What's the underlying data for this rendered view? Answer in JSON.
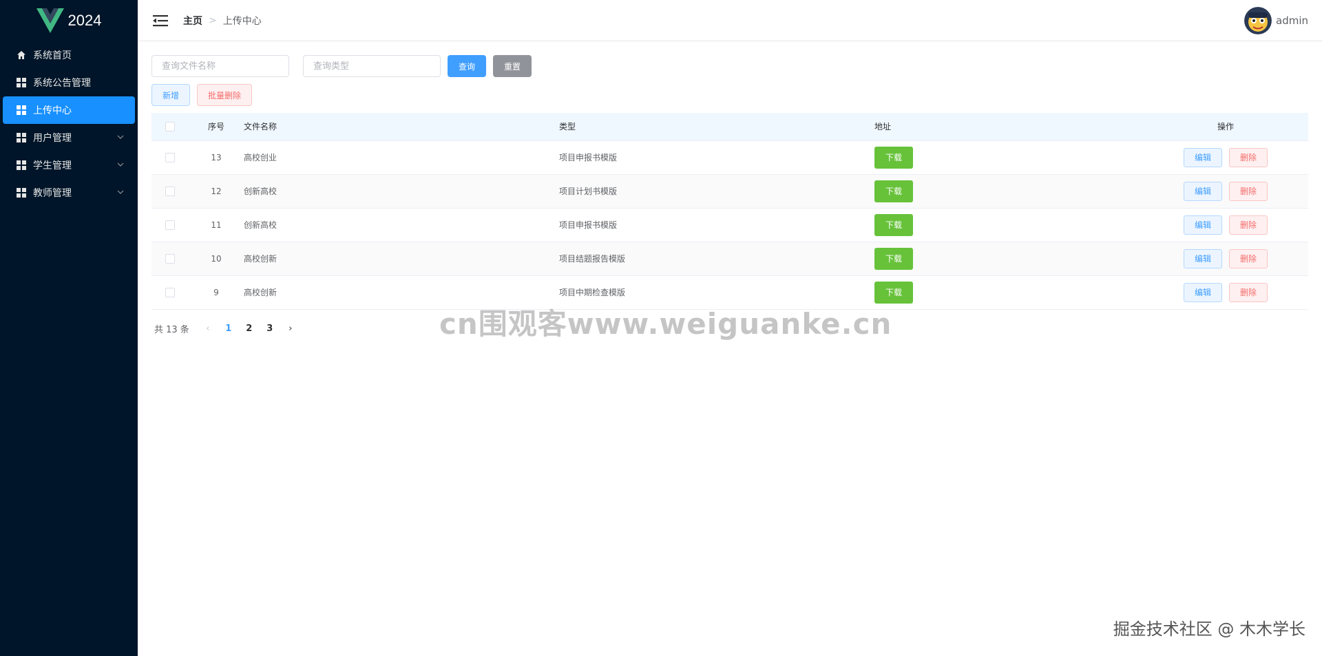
{
  "logo": {
    "text": "2024"
  },
  "sidebar": {
    "items": [
      {
        "label": "系统首页",
        "icon": "home-icon"
      },
      {
        "label": "系统公告管理",
        "icon": "grid-icon"
      },
      {
        "label": "上传中心",
        "icon": "grid-icon",
        "active": true
      },
      {
        "label": "用户管理",
        "icon": "grid-icon",
        "expandable": true
      },
      {
        "label": "学生管理",
        "icon": "grid-icon",
        "expandable": true
      },
      {
        "label": "教师管理",
        "icon": "grid-icon",
        "expandable": true
      }
    ]
  },
  "header": {
    "breadcrumb": {
      "home": "主页",
      "separator": ">",
      "current": "上传中心"
    },
    "user": {
      "name": "admin"
    }
  },
  "search": {
    "name_placeholder": "查询文件名称",
    "type_placeholder": "查询类型",
    "query_label": "查询",
    "reset_label": "重置"
  },
  "actions": {
    "add_label": "新增",
    "batch_delete_label": "批量删除"
  },
  "table": {
    "headers": {
      "index": "序号",
      "name": "文件名称",
      "type": "类型",
      "address": "地址",
      "operation": "操作"
    },
    "download_label": "下载",
    "edit_label": "编辑",
    "delete_label": "删除",
    "rows": [
      {
        "index": "13",
        "name": "高校创业",
        "type": "项目申报书模版"
      },
      {
        "index": "12",
        "name": "创新高校",
        "type": "项目计划书模版"
      },
      {
        "index": "11",
        "name": "创新高校",
        "type": "项目申报书模版"
      },
      {
        "index": "10",
        "name": "高校创新",
        "type": "项目结题报告模版"
      },
      {
        "index": "9",
        "name": "高校创新",
        "type": "项目中期检查模版"
      }
    ]
  },
  "pagination": {
    "total": "共 13 条",
    "pages": [
      "1",
      "2",
      "3"
    ],
    "current": "1",
    "prev": "‹",
    "next": "›"
  },
  "watermarks": {
    "center": "cn围观客www.weiguanke.cn",
    "corner": "掘金技术社区 @ 木木学长"
  },
  "colors": {
    "sidebar_bg": "#001529",
    "active_menu": "#1890ff",
    "primary": "#409eff",
    "success": "#67c23a",
    "danger": "#f56c6c",
    "info": "#909399"
  }
}
